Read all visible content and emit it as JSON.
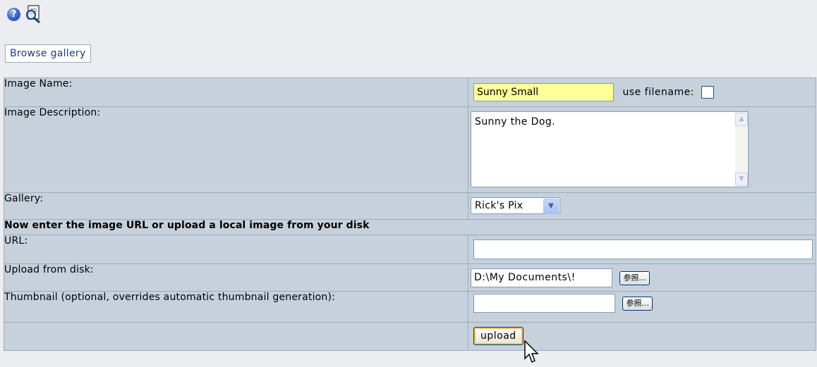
{
  "toolbar": {
    "icons": [
      "help-icon",
      "zoom-icon"
    ]
  },
  "browse_link": "Browse gallery",
  "form": {
    "image_name": {
      "label": "Image Name:",
      "value": "Sunny Small",
      "use_filename_label": "use filename:"
    },
    "image_description": {
      "label": "Image Description:",
      "value": "Sunny the Dog."
    },
    "gallery": {
      "label": "Gallery:",
      "selected": "Rick's Pix"
    },
    "section_heading": "Now enter the image URL or upload a local image from your disk",
    "url": {
      "label": "URL:",
      "value": ""
    },
    "upload_from_disk": {
      "label": "Upload from disk:",
      "value": "D:\\My Documents\\!",
      "browse_label": "参照..."
    },
    "thumbnail": {
      "label": "Thumbnail (optional, overrides automatic thumbnail generation):",
      "value": "",
      "browse_label": "参照..."
    },
    "submit_label": "upload"
  },
  "colors": {
    "highlight_input": "#ffff99",
    "table_bg": "#c7d1dc",
    "page_bg": "#ecedf1",
    "border": "#9aacbf"
  }
}
